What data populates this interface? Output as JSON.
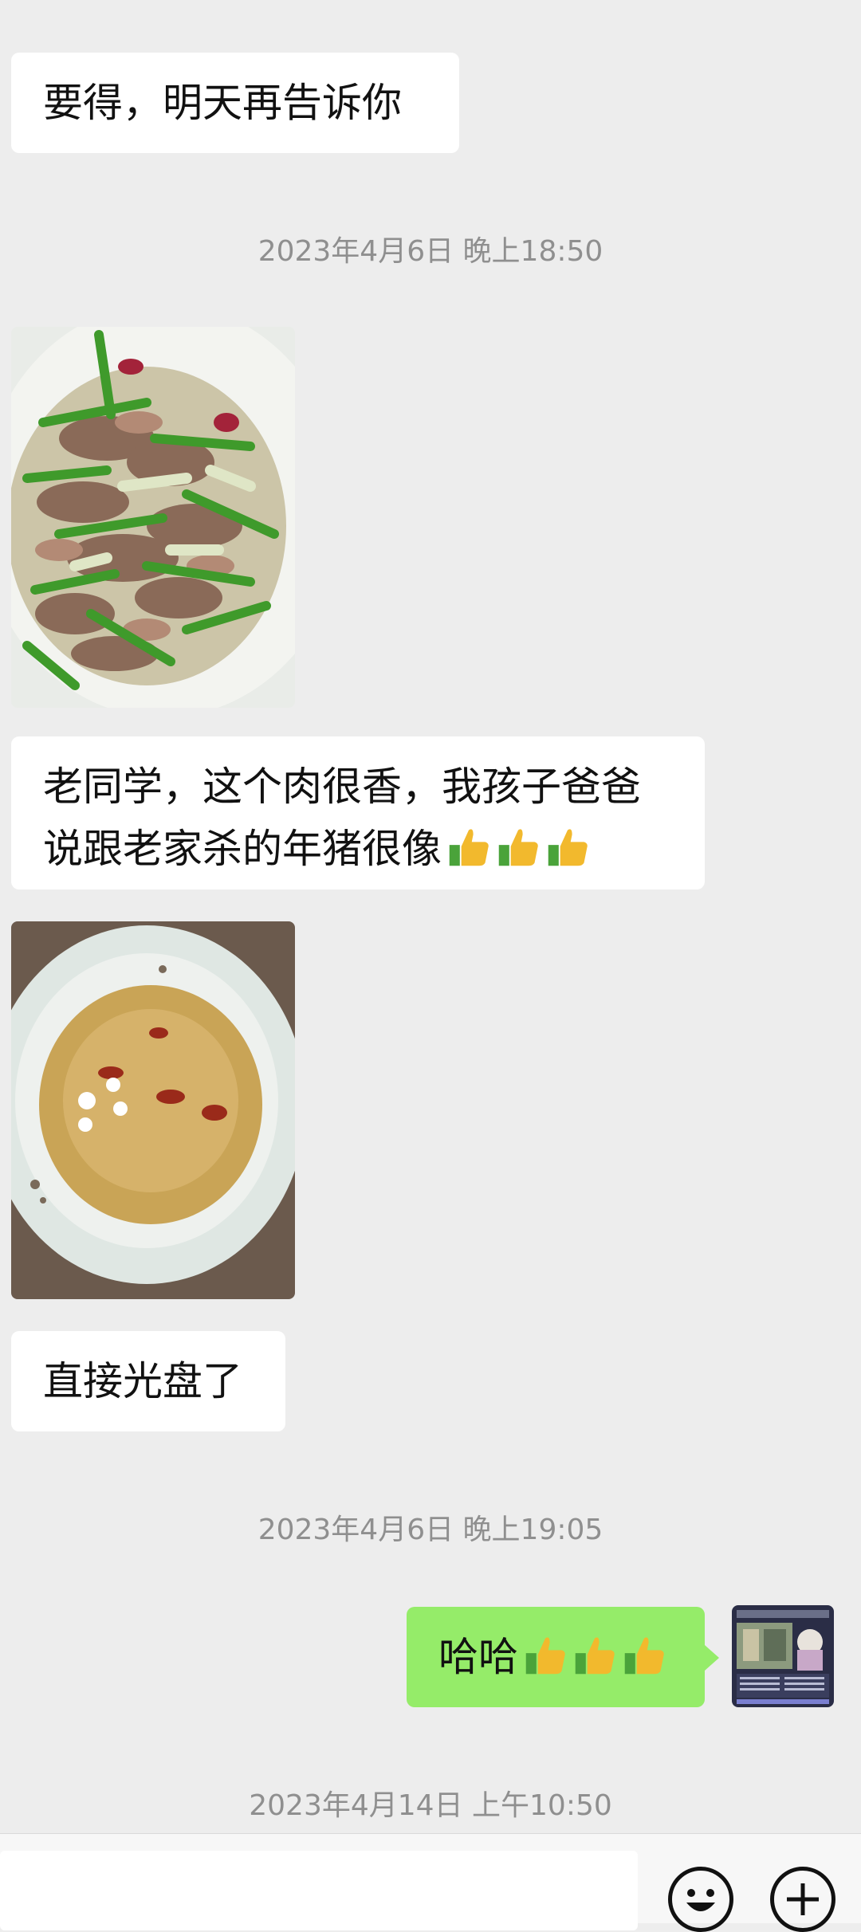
{
  "messages": {
    "m1": {
      "text": "要得，明天再告诉你"
    },
    "ts1": "2023年4月6日 晚上18:50",
    "m2_line1": "老同学，这个肉很香，我孩子爸爸",
    "m2_line2": "说跟老家杀的年猪很像",
    "m3": "直接光盘了",
    "ts2": "2023年4月6日 晚上19:05",
    "m4": "哈哈",
    "ts3": "2023年4月14日 上午10:50"
  },
  "colors": {
    "chat_bg": "#ededed",
    "incoming_bubble": "#ffffff",
    "outgoing_bubble": "#95ec69",
    "timestamp": "#8f8f8f"
  },
  "icons": [
    "thumbs-up-icon",
    "emoji-icon",
    "plus-icon"
  ]
}
